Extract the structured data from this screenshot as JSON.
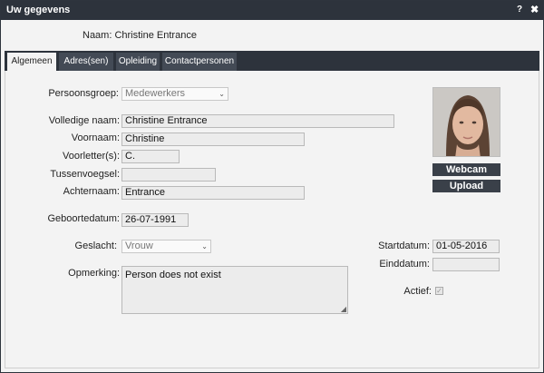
{
  "window": {
    "title": "Uw gegevens",
    "help_label": "?",
    "close_label": "✖"
  },
  "header": {
    "naam_text": "Naam: Christine Entrance"
  },
  "tabs": [
    {
      "label": "Algemeen",
      "active": true
    },
    {
      "label": "Adres(sen)",
      "active": false
    },
    {
      "label": "Opleiding",
      "active": false
    },
    {
      "label": "Contactpersonen",
      "active": false
    }
  ],
  "form": {
    "persoonsgroep": {
      "label": "Persoonsgroep:",
      "value": "Medewerkers"
    },
    "volledige_naam": {
      "label": "Volledige naam:",
      "value": "Christine Entrance"
    },
    "voornaam": {
      "label": "Voornaam:",
      "value": "Christine"
    },
    "voorletters": {
      "label": "Voorletter(s):",
      "value": "C."
    },
    "tussenvoegsel": {
      "label": "Tussenvoegsel:",
      "value": ""
    },
    "achternaam": {
      "label": "Achternaam:",
      "value": "Entrance"
    },
    "geboortedatum": {
      "label": "Geboortedatum:",
      "value": "26-07-1991"
    },
    "geslacht": {
      "label": "Geslacht:",
      "value": "Vrouw"
    },
    "opmerking": {
      "label": "Opmerking:",
      "value": "Person does not exist"
    },
    "startdatum": {
      "label": "Startdatum:",
      "value": "01-05-2016"
    },
    "einddatum": {
      "label": "Einddatum:",
      "value": ""
    },
    "actief": {
      "label": "Actief:",
      "checked": true,
      "check_glyph": "✓"
    }
  },
  "photo": {
    "webcam_label": "Webcam",
    "upload_label": "Upload"
  },
  "icons": {
    "dropdown": "chevron-down-icon",
    "resize": "resize-grip-icon"
  },
  "glyphs": {
    "chevron": "⌄",
    "grip": "◢"
  },
  "colors": {
    "titlebar": "#2d333c",
    "tab_inactive": "#434a55",
    "button": "#3a4049",
    "panel": "#f3f3f3"
  }
}
